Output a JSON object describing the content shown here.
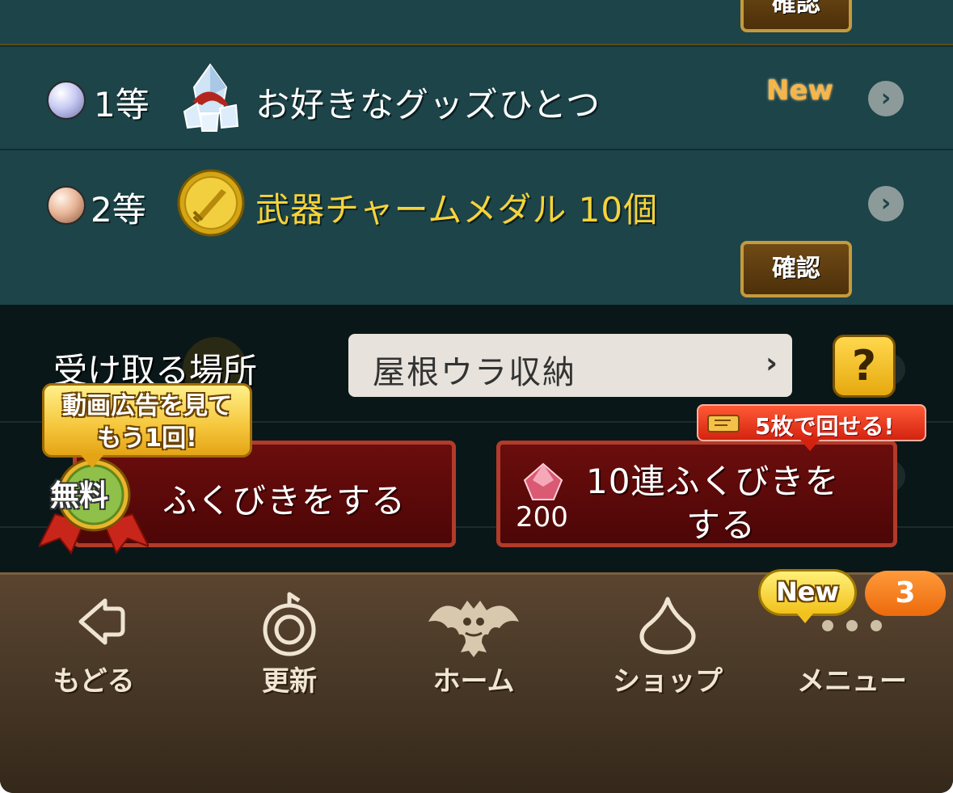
{
  "prize_list": {
    "top_confirm_label": "確認",
    "rows": [
      {
        "rank": "1等",
        "title": "お好きなグッズひとつ",
        "new_label": "New"
      },
      {
        "rank": "2等",
        "title": "武器チャームメダル  10個",
        "confirm_label": "確認"
      }
    ]
  },
  "receive": {
    "label": "受け取る場所",
    "place_value": "屋根ウラ収納",
    "help_symbol": "?"
  },
  "draw_single": {
    "bubble_line1": "動画広告を見て",
    "bubble_line2": "もう1回!",
    "free_badge": "無料",
    "label": "ふくびきをする"
  },
  "draw_ten": {
    "ticket_note": "5枚で回せる!",
    "label_line1": "10連ふくびきを",
    "label_line2": "する",
    "cost": "200"
  },
  "bottom_nav": {
    "items": [
      {
        "label": "もどる",
        "icon": "back-arrow-icon"
      },
      {
        "label": "更新",
        "icon": "refresh-icon"
      },
      {
        "label": "ホーム",
        "icon": "dracky-home-icon"
      },
      {
        "label": "ショップ",
        "icon": "slime-shop-icon"
      },
      {
        "label": "メニュー",
        "icon": "more-dots-icon"
      }
    ],
    "new_badge": "New",
    "count_badge": "3"
  },
  "colors": {
    "panel": "#1d4448",
    "gold_text": "#f7d33a",
    "button_red": "#6b0d0d",
    "nav_brown": "#4b3a28"
  }
}
